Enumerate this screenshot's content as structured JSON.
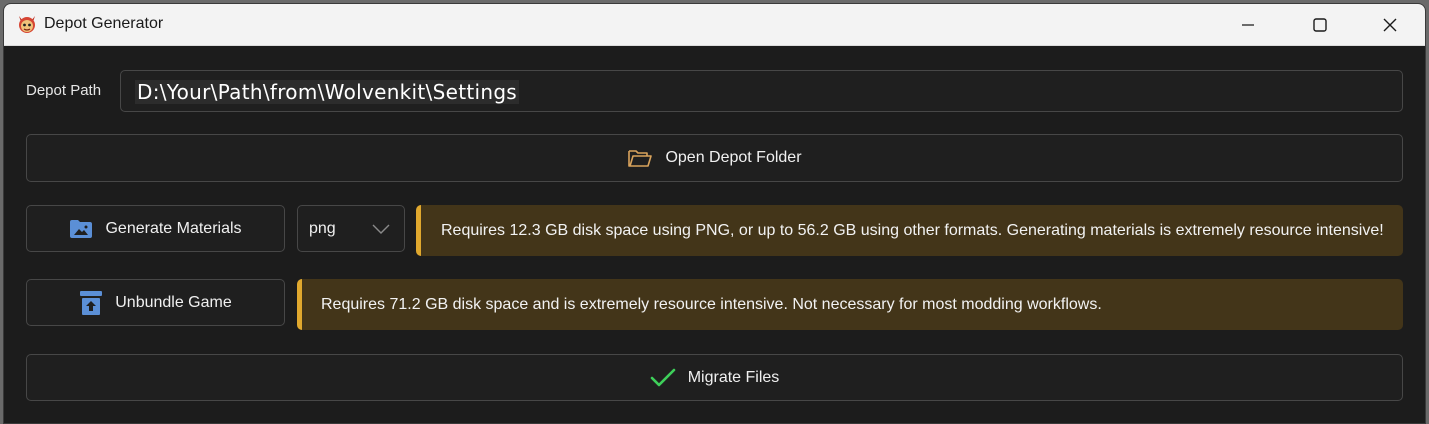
{
  "window": {
    "title": "Depot Generator",
    "app_icon": "devil-mascot-icon",
    "controls": [
      "minimize-icon",
      "maximize-icon",
      "close-icon"
    ]
  },
  "depot": {
    "label": "Depot Path",
    "path_value": "D:\\Your\\Path\\from\\Wolvenkit\\Settings"
  },
  "buttons": {
    "open_depot": {
      "label": "Open Depot Folder",
      "icon": "folder-open-icon",
      "icon_color": "#d9a35c"
    },
    "generate_materials": {
      "label": "Generate Materials",
      "icon": "image-folder-icon",
      "icon_color": "#5b8fd6"
    },
    "unbundle_game": {
      "label": "Unbundle Game",
      "icon": "archive-upload-icon",
      "icon_color": "#5b8fd6"
    },
    "migrate_files": {
      "label": "Migrate Files",
      "icon": "checkmark-icon",
      "icon_color": "#3ecf5a"
    }
  },
  "format_select": {
    "selected": "png"
  },
  "warnings": {
    "materials": "Requires 12.3 GB disk space using PNG, or up to 56.2 GB using other formats. Generating materials is extremely resource intensive!",
    "unbundle": "Requires 71.2 GB disk space and is extremely resource intensive. Not necessary for most modding workflows."
  },
  "colors": {
    "background": "#1c1c1c",
    "titlebar": "#f3f3f3",
    "warning_bg": "#433519",
    "warning_accent": "#e0a82e"
  }
}
